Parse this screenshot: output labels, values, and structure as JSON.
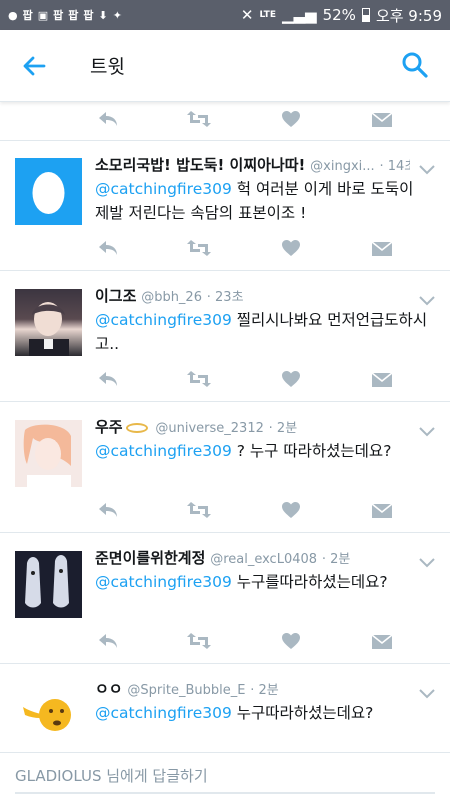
{
  "statusbar": {
    "notification_icons": [
      "팝",
      "팝",
      "팝",
      "팝"
    ],
    "battery": "52%",
    "time": "오후 9:59",
    "network": "LTE"
  },
  "header": {
    "title": "트윗"
  },
  "tweets": [
    {
      "name": "소모리국밥! 밥도둑! 이찌아나따!",
      "handle": "@xingxi...",
      "time": "14초",
      "mention": "@catchingfire309",
      "text": " 헉 여러분 이게 바로 도둑이 제발 저린다는 속담의 표본이조 !"
    },
    {
      "name": "이그조",
      "handle": "@bbh_26",
      "time": "23초",
      "mention": "@catchingfire309",
      "text": " 찔리시나봐요 먼저언급도하시고.."
    },
    {
      "name": "우주",
      "handle": "@universe_2312",
      "time": "2분",
      "mention": "@catchingfire309",
      "text": " ? 누구 따라하셨는데요?"
    },
    {
      "name": "준면이를위한계정",
      "handle": "@real_excL0408",
      "time": "2분",
      "mention": "@catchingfire309",
      "text": " 누구를따라하셨는데요?"
    },
    {
      "name": "ㅇㅇ",
      "handle": "@Sprite_Bubble_E",
      "time": "2분",
      "mention": "@catchingfire309",
      "text": " 누구따라하셨는데요?"
    }
  ],
  "reply": {
    "placeholder": "GLADIOLUS 님에게 답글하기"
  },
  "colors": {
    "accent": "#1da1f2",
    "icon_gray": "#aab8c2",
    "statusbar": "#5a5f6b"
  },
  "icons": [
    "back-arrow-icon",
    "search-icon",
    "reply-icon",
    "retweet-icon",
    "like-icon",
    "dm-icon",
    "chevron-down-icon",
    "egg-avatar-icon",
    "halo-emoji-icon",
    "emoji-face-icon"
  ]
}
